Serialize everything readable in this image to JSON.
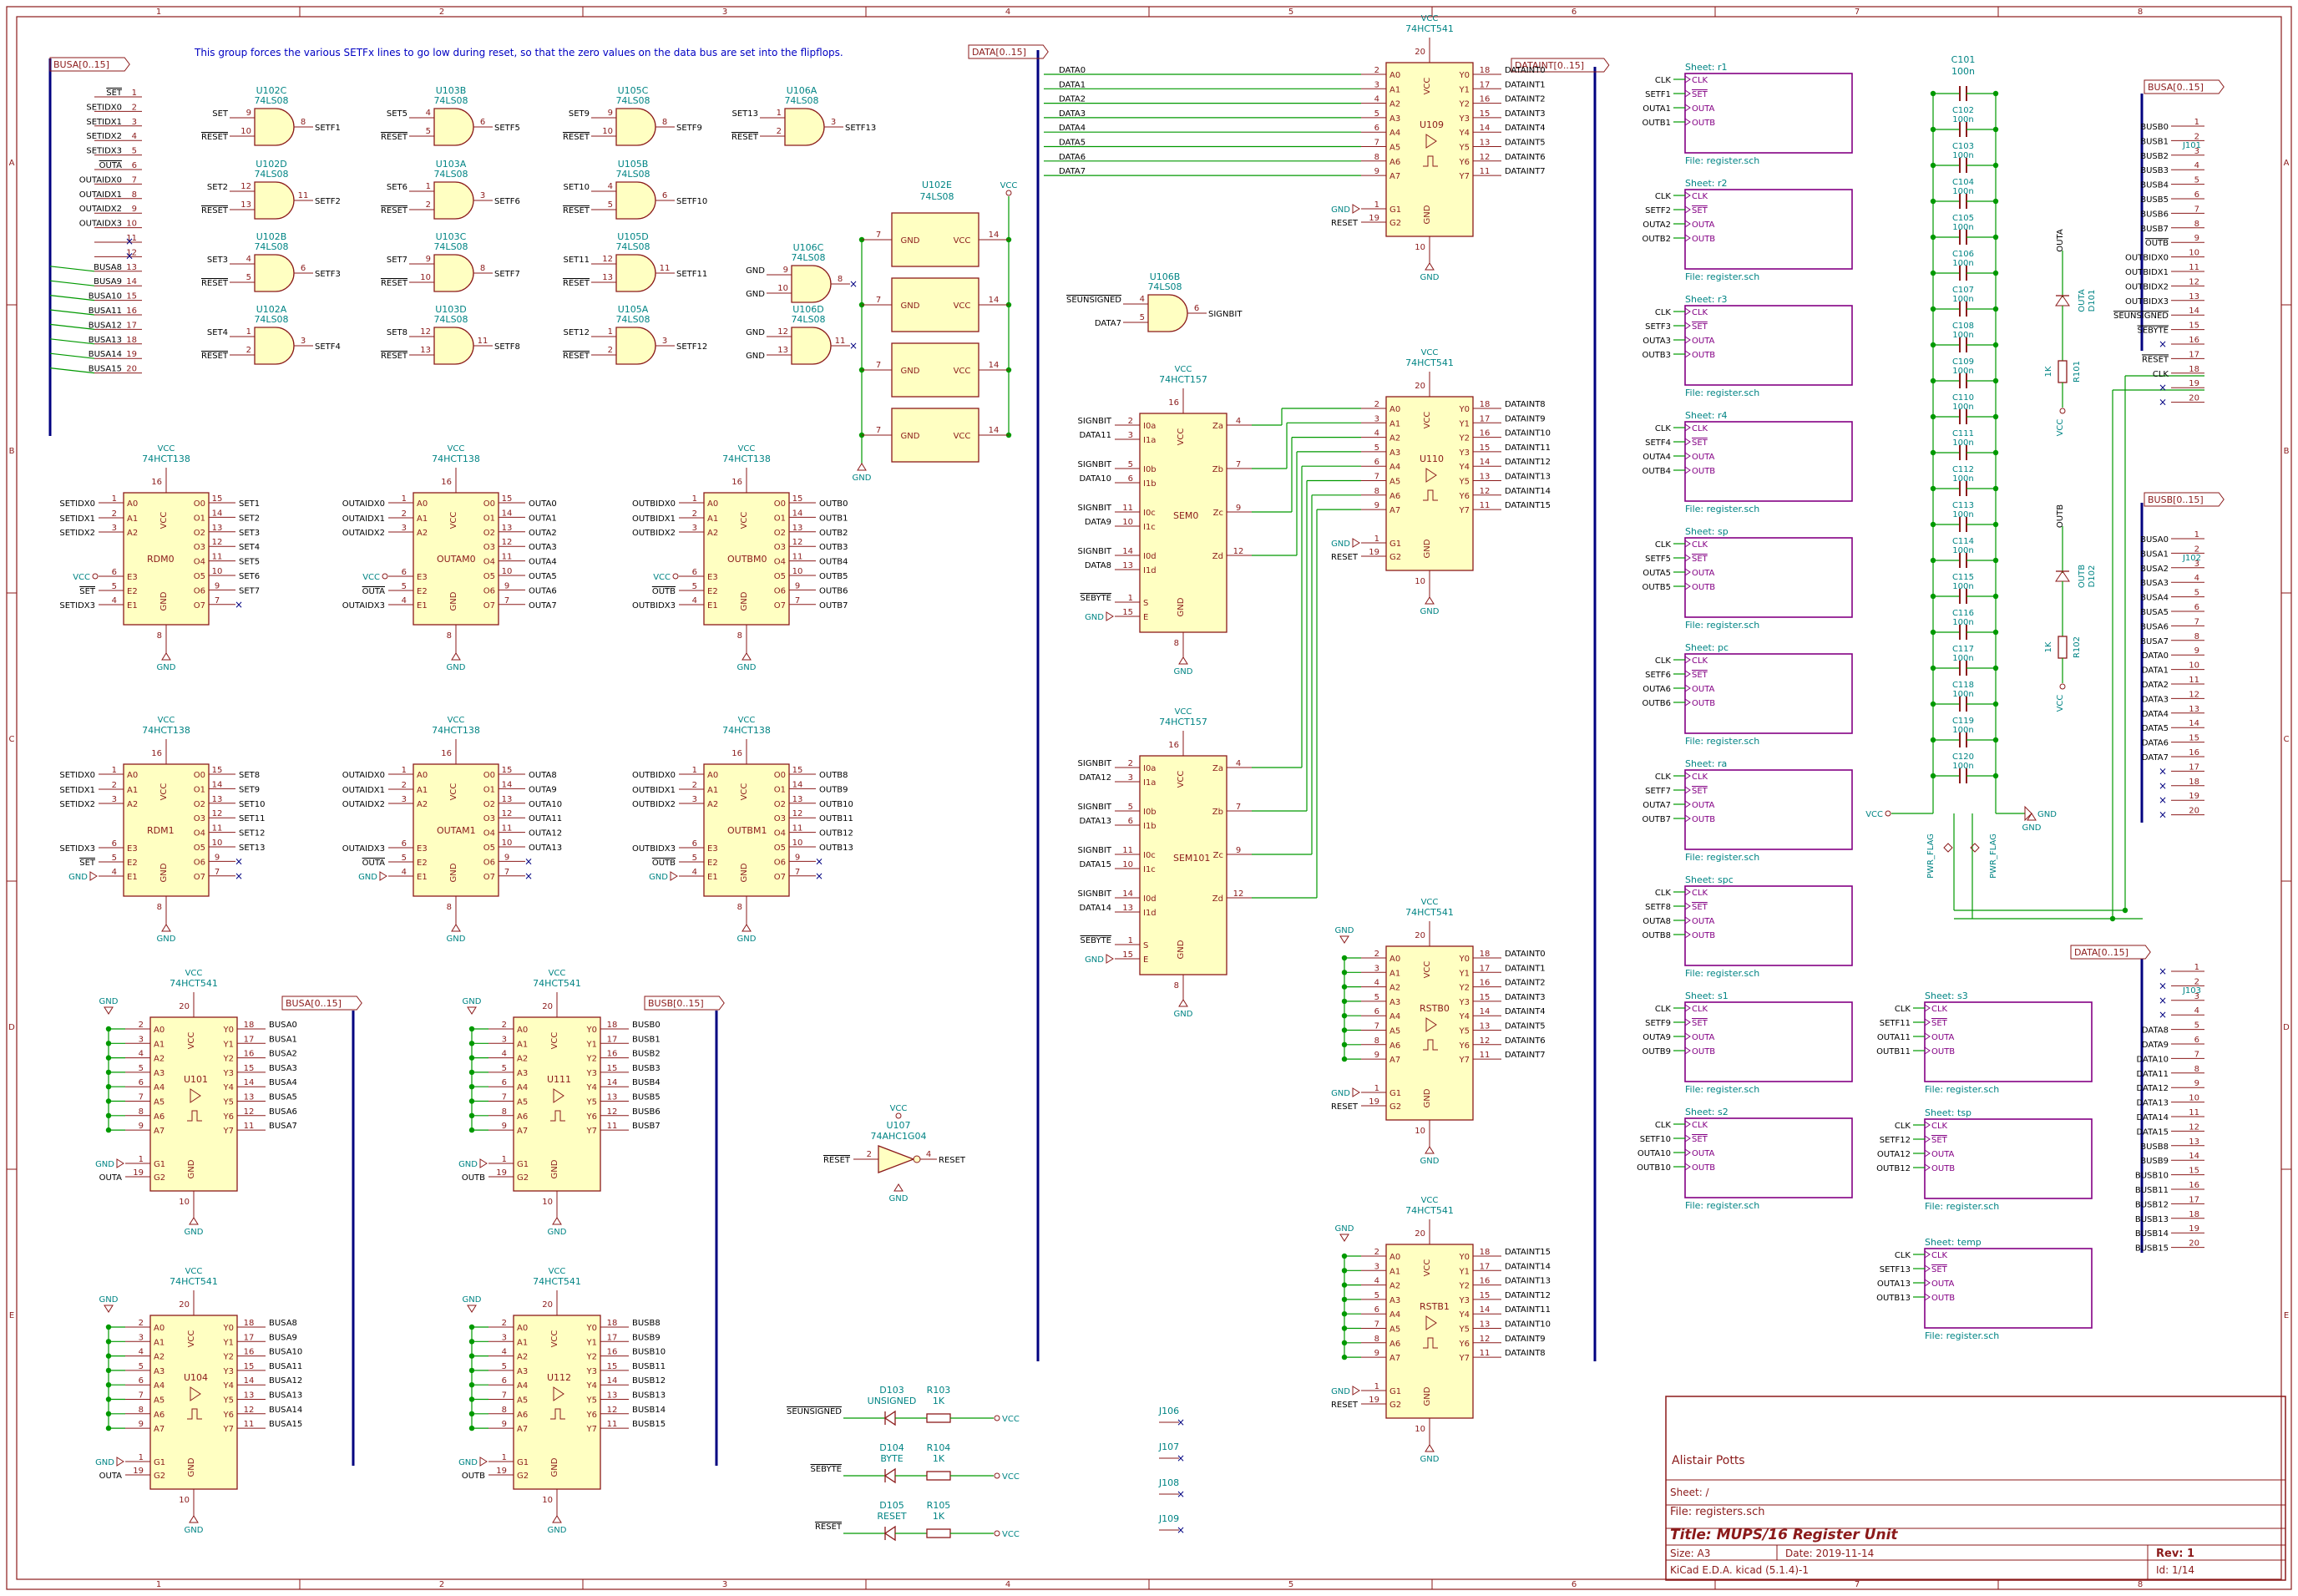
{
  "frame": {
    "columns": [
      "1",
      "2",
      "3",
      "4",
      "5",
      "6",
      "7",
      "8"
    ],
    "rows": [
      "A",
      "B",
      "C",
      "D",
      "E"
    ]
  },
  "comment": "This group forces the various SETFx lines to go low during reset, so that the zero values on the data bus are set into the flipflops.",
  "buses": {
    "busa": "BUSA[0..15]",
    "busb": "BUSB[0..15]",
    "data": "DATA[0..15]",
    "dataint": "DATAINT[0..15]"
  },
  "left_connector_nets": [
    "SET",
    "SETIDX0",
    "SETIDX1",
    "SETIDX2",
    "SETIDX3",
    "OUTA",
    "OUTAIDX0",
    "OUTAIDX1",
    "OUTAIDX2",
    "OUTAIDX3",
    "",
    "",
    "BUSA8",
    "BUSA9",
    "BUSA10",
    "BUSA11",
    "BUSA12",
    "BUSA13",
    "BUSA14",
    "BUSA15"
  ],
  "left_connector_pins": [
    "1",
    "2",
    "3",
    "4",
    "5",
    "6",
    "7",
    "8",
    "9",
    "10",
    "11",
    "12",
    "13",
    "14",
    "15",
    "16",
    "17",
    "18",
    "19",
    "20"
  ],
  "nand_gates": [
    {
      "ref": "U102C",
      "value": "74LS08",
      "in1": "SET",
      "in2": "RESET",
      "p1": "9",
      "p2": "10",
      "po": "8",
      "out": "SETF1"
    },
    {
      "ref": "U102D",
      "value": "74LS08",
      "in1": "SET2",
      "in2": "RESET",
      "p1": "12",
      "p2": "13",
      "po": "11",
      "out": "SETF2"
    },
    {
      "ref": "U102B",
      "value": "74LS08",
      "in1": "SET3",
      "in2": "RESET",
      "p1": "4",
      "p2": "5",
      "po": "6",
      "out": "SETF3"
    },
    {
      "ref": "U102A",
      "value": "74LS08",
      "in1": "SET4",
      "in2": "RESET",
      "p1": "1",
      "p2": "2",
      "po": "3",
      "out": "SETF4"
    },
    {
      "ref": "U103B",
      "value": "74LS08",
      "in1": "SET5",
      "in2": "RESET",
      "p1": "4",
      "p2": "5",
      "po": "6",
      "out": "SETF5"
    },
    {
      "ref": "U103A",
      "value": "74LS08",
      "in1": "SET6",
      "in2": "RESET",
      "p1": "1",
      "p2": "2",
      "po": "3",
      "out": "SETF6"
    },
    {
      "ref": "U103C",
      "value": "74LS08",
      "in1": "SET7",
      "in2": "RESET",
      "p1": "9",
      "p2": "10",
      "po": "8",
      "out": "SETF7"
    },
    {
      "ref": "U103D",
      "value": "74LS08",
      "in1": "SET8",
      "in2": "RESET",
      "p1": "12",
      "p2": "13",
      "po": "11",
      "out": "SETF8"
    },
    {
      "ref": "U105C",
      "value": "74LS08",
      "in1": "SET9",
      "in2": "RESET",
      "p1": "9",
      "p2": "10",
      "po": "8",
      "out": "SETF9"
    },
    {
      "ref": "U105B",
      "value": "74LS08",
      "in1": "SET10",
      "in2": "RESET",
      "p1": "4",
      "p2": "5",
      "po": "6",
      "out": "SETF10"
    },
    {
      "ref": "U105D",
      "value": "74LS08",
      "in1": "SET11",
      "in2": "RESET",
      "p1": "12",
      "p2": "13",
      "po": "11",
      "out": "SETF11"
    },
    {
      "ref": "U105A",
      "value": "74LS08",
      "in1": "SET12",
      "in2": "RESET",
      "p1": "1",
      "p2": "2",
      "po": "3",
      "out": "SETF12"
    },
    {
      "ref": "U106A",
      "value": "74LS08",
      "in1": "SET13",
      "in2": "RESET",
      "p1": "1",
      "p2": "2",
      "po": "3",
      "out": "SETF13"
    },
    {
      "ref": "U106C",
      "value": "74LS08",
      "in1": "GND",
      "in2": "GND",
      "p1": "9",
      "p2": "10",
      "po": "8",
      "out": ""
    },
    {
      "ref": "U106D",
      "value": "74LS08",
      "in1": "GND",
      "in2": "GND",
      "p1": "12",
      "p2": "13",
      "po": "11",
      "out": ""
    },
    {
      "ref": "U106B",
      "value": "74LS08",
      "in1": "SEUNSIGNED",
      "in2": "DATA7",
      "p1": "4",
      "p2": "5",
      "po": "6",
      "out": "SIGNBIT"
    }
  ],
  "u102e": {
    "ref": "U102E",
    "value": "74LS08",
    "gnd": "GND",
    "vcc": "VCC",
    "p7": "7",
    "p14": "14"
  },
  "decoders": [
    {
      "ref": "RDM0",
      "value": "74HCT138",
      "inputs": [
        "SETIDX0",
        "SETIDX1",
        "SETIDX2",
        "VCC",
        "SET",
        "SETIDX3"
      ],
      "outputs": [
        "SET1",
        "SET2",
        "SET3",
        "SET4",
        "SET5",
        "SET6",
        "SET7"
      ]
    },
    {
      "ref": "OUTAM0",
      "value": "74HCT138",
      "inputs": [
        "OUTAIDX0",
        "OUTAIDX1",
        "OUTAIDX2",
        "VCC",
        "OUTA",
        "OUTAIDX3"
      ],
      "outputs": [
        "OUTA0",
        "OUTA1",
        "OUTA2",
        "OUTA3",
        "OUTA4",
        "OUTA5",
        "OUTA6",
        "OUTA7"
      ]
    },
    {
      "ref": "OUTBM0",
      "value": "74HCT138",
      "inputs": [
        "OUTBIDX0",
        "OUTBIDX1",
        "OUTBIDX2",
        "VCC",
        "OUTB",
        "OUTBIDX3"
      ],
      "outputs": [
        "OUTB0",
        "OUTB1",
        "OUTB2",
        "OUTB3",
        "OUTB4",
        "OUTB5",
        "OUTB6",
        "OUTB7"
      ]
    },
    {
      "ref": "RDM1",
      "value": "74HCT138",
      "inputs": [
        "SETIDX0",
        "SETIDX1",
        "SETIDX2",
        "SETIDX3",
        "SET",
        "GND"
      ],
      "outputs": [
        "SET8",
        "SET9",
        "SET10",
        "SET11",
        "SET12",
        "SET13"
      ]
    },
    {
      "ref": "OUTAM1",
      "value": "74HCT138",
      "inputs": [
        "OUTAIDX0",
        "OUTAIDX1",
        "OUTAIDX2",
        "OUTAIDX3",
        "OUTA",
        "GND"
      ],
      "outputs": [
        "OUTA8",
        "OUTA9",
        "OUTA10",
        "OUTA11",
        "OUTA12",
        "OUTA13"
      ]
    },
    {
      "ref": "OUTBM1",
      "value": "74HCT138",
      "inputs": [
        "OUTBIDX0",
        "OUTBIDX1",
        "OUTBIDX2",
        "OUTBIDX3",
        "OUTB",
        "GND"
      ],
      "outputs": [
        "OUTB8",
        "OUTB9",
        "OUTB10",
        "OUTB11",
        "OUTB12",
        "OUTB13"
      ]
    }
  ],
  "decoder_pin_names_in": [
    "A0",
    "A1",
    "A2",
    "E3",
    "E2",
    "E1"
  ],
  "decoder_pin_nums_in": [
    "1",
    "2",
    "3",
    "6",
    "5",
    "4"
  ],
  "decoder_pin_names_out": [
    "O0",
    "O1",
    "O2",
    "O3",
    "O4",
    "O5",
    "O6",
    "O7"
  ],
  "decoder_pin_nums_out": [
    "15",
    "14",
    "13",
    "12",
    "11",
    "10",
    "9",
    "7"
  ],
  "buffers": [
    {
      "ref": "U101",
      "value": "74HCT541",
      "g1": "GND",
      "g2": "OUTA",
      "outs": [
        "BUSA0",
        "BUSA1",
        "BUSA2",
        "BUSA3",
        "BUSA4",
        "BUSA5",
        "BUSA6",
        "BUSA7"
      ]
    },
    {
      "ref": "U111",
      "value": "74HCT541",
      "g1": "GND",
      "g2": "OUTB",
      "outs": [
        "BUSB0",
        "BUSB1",
        "BUSB2",
        "BUSB3",
        "BUSB4",
        "BUSB5",
        "BUSB6",
        "BUSB7"
      ]
    },
    {
      "ref": "U104",
      "value": "74HCT541",
      "g1": "GND",
      "g2": "OUTA",
      "outs": [
        "BUSA8",
        "BUSA9",
        "BUSA10",
        "BUSA11",
        "BUSA12",
        "BUSA13",
        "BUSA14",
        "BUSA15"
      ]
    },
    {
      "ref": "U112",
      "value": "74HCT541",
      "g1": "GND",
      "g2": "OUTB",
      "outs": [
        "BUSB8",
        "BUSB9",
        "BUSB10",
        "BUSB11",
        "BUSB12",
        "BUSB13",
        "BUSB14",
        "BUSB15"
      ]
    },
    {
      "ref": "U109",
      "value": "74HCT541",
      "g1": "GND",
      "g2": "RESET",
      "outs": [
        "DATAINT0",
        "DATAINT1",
        "DATAINT2",
        "DATAINT3",
        "DATAINT4",
        "DATAINT5",
        "DATAINT6",
        "DATAINT7"
      ]
    },
    {
      "ref": "U110",
      "value": "74HCT541",
      "g1": "GND",
      "g2": "RESET",
      "outs": [
        "DATAINT8",
        "DATAINT9",
        "DATAINT10",
        "DATAINT11",
        "DATAINT12",
        "DATAINT13",
        "DATAINT14",
        "DATAINT15"
      ]
    },
    {
      "ref": "RSTB0",
      "value": "74HCT541",
      "g1": "GND",
      "g2": "RESET",
      "outs": [
        "DATAINT0",
        "DATAINT1",
        "DATAINT2",
        "DATAINT3",
        "DATAINT4",
        "DATAINT5",
        "DATAINT6",
        "DATAINT7"
      ]
    },
    {
      "ref": "RSTB1",
      "value": "74HCT541",
      "g1": "GND",
      "g2": "RESET",
      "outs": [
        "DATAINT15",
        "DATAINT14",
        "DATAINT13",
        "DATAINT12",
        "DATAINT11",
        "DATAINT10",
        "DATAINT9",
        "DATAINT8"
      ]
    }
  ],
  "buffer_pin_names_in": [
    "A0",
    "A1",
    "A2",
    "A3",
    "A4",
    "A5",
    "A6",
    "A7"
  ],
  "buffer_pin_nums_in": [
    "2",
    "3",
    "4",
    "5",
    "6",
    "7",
    "8",
    "9"
  ],
  "buffer_pin_names_out": [
    "Y0",
    "Y1",
    "Y2",
    "Y3",
    "Y4",
    "Y5",
    "Y6",
    "Y7"
  ],
  "buffer_pin_nums_out": [
    "18",
    "17",
    "16",
    "15",
    "14",
    "13",
    "12",
    "11"
  ],
  "u109_inputs": [
    "DATA0",
    "DATA1",
    "DATA2",
    "DATA3",
    "DATA4",
    "DATA5",
    "DATA6",
    "DATA7"
  ],
  "muxes": [
    {
      "ref": "SEM0",
      "value": "74HCT157",
      "ins": [
        "SIGNBIT",
        "DATA11",
        "SIGNBIT",
        "DATA10",
        "SIGNBIT",
        "DATA9",
        "SIGNBIT",
        "DATA8"
      ],
      "s": "SEBYTE",
      "e": "GND"
    },
    {
      "ref": "SEM101",
      "value": "74HCT157",
      "ins": [
        "SIGNBIT",
        "DATA12",
        "SIGNBIT",
        "DATA13",
        "SIGNBIT",
        "DATA15",
        "SIGNBIT",
        "DATA14"
      ],
      "s": "SEBYTE",
      "e": "GND"
    }
  ],
  "mux_pin_names_in": [
    "I0a",
    "I1a",
    "I0b",
    "I1b",
    "I0c",
    "I1c",
    "I0d",
    "I1d"
  ],
  "mux_pin_nums_in": [
    "2",
    "3",
    "5",
    "6",
    "11",
    "10",
    "14",
    "13"
  ],
  "mux_pin_names_out": [
    "Za",
    "Zb",
    "Zc",
    "Zd"
  ],
  "mux_pin_nums_out": [
    "4",
    "7",
    "9",
    "12"
  ],
  "inverter": {
    "ref": "U107",
    "value": "74AHC1G04",
    "in": "RESET",
    "out": "RESET",
    "pin_in": "2",
    "pin_out": "4"
  },
  "leds": [
    {
      "ref": "D103",
      "value": "UNSIGNED",
      "net": "SEUNSIGNED",
      "res": "R103",
      "rval": "1K"
    },
    {
      "ref": "D104",
      "value": "BYTE",
      "net": "SEBYTE",
      "res": "R104",
      "rval": "1K"
    },
    {
      "ref": "D105",
      "value": "RESET",
      "net": "RESET",
      "res": "R105",
      "rval": "1K"
    }
  ],
  "jumpers": [
    "J106",
    "J107",
    "J108",
    "J109"
  ],
  "sheets": [
    {
      "name": "Sheet: r1",
      "pins": [
        "CLK",
        "SETF1",
        "OUTA1",
        "OUTB1"
      ]
    },
    {
      "name": "Sheet: r2",
      "pins": [
        "CLK",
        "SETF2",
        "OUTA2",
        "OUTB2"
      ]
    },
    {
      "name": "Sheet: r3",
      "pins": [
        "CLK",
        "SETF3",
        "OUTA3",
        "OUTB3"
      ]
    },
    {
      "name": "Sheet: r4",
      "pins": [
        "CLK",
        "SETF4",
        "OUTA4",
        "OUTB4"
      ]
    },
    {
      "name": "Sheet: sp",
      "pins": [
        "CLK",
        "SETF5",
        "OUTA5",
        "OUTB5"
      ]
    },
    {
      "name": "Sheet: pc",
      "pins": [
        "CLK",
        "SETF6",
        "OUTA6",
        "OUTB6"
      ]
    },
    {
      "name": "Sheet: ra",
      "pins": [
        "CLK",
        "SETF7",
        "OUTA7",
        "OUTB7"
      ]
    },
    {
      "name": "Sheet: spc",
      "pins": [
        "CLK",
        "SETF8",
        "OUTA8",
        "OUTB8"
      ]
    },
    {
      "name": "Sheet: s1",
      "pins": [
        "CLK",
        "SETF9",
        "OUTA9",
        "OUTB9"
      ]
    },
    {
      "name": "Sheet: s2",
      "pins": [
        "CLK",
        "SETF10",
        "OUTA10",
        "OUTB10"
      ]
    },
    {
      "name": "Sheet: s3",
      "pins": [
        "CLK",
        "SETF11",
        "OUTA11",
        "OUTB11"
      ]
    },
    {
      "name": "Sheet: tsp",
      "pins": [
        "CLK",
        "SETF12",
        "OUTA12",
        "OUTB12"
      ]
    },
    {
      "name": "Sheet: temp",
      "pins": [
        "CLK",
        "SETF13",
        "OUTA13",
        "OUTB13"
      ]
    }
  ],
  "sheet_pin_labels": [
    "CLK",
    "SET",
    "OUTA",
    "OUTB"
  ],
  "sheet_file": "File: register.sch",
  "capacitors": {
    "refs": [
      "C101",
      "C102",
      "C103",
      "C104",
      "C105",
      "C106",
      "C107",
      "C108",
      "C109",
      "C110",
      "C111",
      "C112",
      "C113",
      "C114",
      "C115",
      "C116",
      "C117",
      "C118",
      "C119",
      "C120"
    ],
    "value": "100n"
  },
  "power_flags": [
    "PWR_FLAG",
    "PWR_FLAG"
  ],
  "indicator_leds": [
    {
      "ref": "D101",
      "value": "OUTA",
      "net": "OUTA",
      "res": "R101",
      "rval": "1K"
    },
    {
      "ref": "D102",
      "value": "OUTB",
      "net": "OUTB",
      "res": "R102",
      "rval": "1K"
    }
  ],
  "j101_nets": [
    "BUSB0",
    "BUSB1",
    "BUSB2",
    "BUSB3",
    "BUSB4",
    "BUSB5",
    "BUSB6",
    "BUSB7",
    "OUTB",
    "OUTBIDX0",
    "OUTBIDX1",
    "OUTBIDX2",
    "OUTBIDX3",
    "SEUNSIGNED",
    "SEBYTE",
    "",
    "RESET",
    "CLK",
    "",
    ""
  ],
  "j101_ref": "J101",
  "j102_nets": [
    "BUSA0",
    "BUSA1",
    "BUSA2",
    "BUSA3",
    "BUSA4",
    "BUSA5",
    "BUSA6",
    "BUSA7",
    "DATA0",
    "DATA1",
    "DATA2",
    "DATA3",
    "DATA4",
    "DATA5",
    "DATA6",
    "DATA7",
    "",
    "",
    "",
    ""
  ],
  "j102_ref": "J102",
  "j103_nets": [
    "",
    "",
    "",
    "",
    "DATA8",
    "DATA9",
    "DATA10",
    "DATA11",
    "DATA12",
    "DATA13",
    "DATA14",
    "DATA15",
    "BUSB8",
    "BUSB9",
    "BUSB10",
    "BUSB11",
    "BUSB12",
    "BUSB13",
    "BUSB14",
    "BUSB15"
  ],
  "j103_ref": "J103",
  "power": {
    "vcc": "VCC",
    "gnd": "GND",
    "reset": "RESET",
    "clk": "CLK"
  },
  "title_block": {
    "author": "Alistair Potts",
    "sheet": "Sheet: /",
    "file": "File: registers.sch",
    "title": "Title: MUPS/16 Register Unit",
    "size": "Size: A3",
    "date": "Date: 2019-11-14",
    "rev": "Rev: 1",
    "tool": "KiCad E.D.A.  kicad (5.1.4)-1",
    "id": "Id: 1/14"
  },
  "colors": {
    "frame": "#8b1a1a",
    "wire": "#009900",
    "bus": "#000080",
    "body": "#ffffc2",
    "pin": "#8b1a1a",
    "ref": "#008484",
    "label": "#000000",
    "sheet": "#840084",
    "text": "#0000c2"
  }
}
